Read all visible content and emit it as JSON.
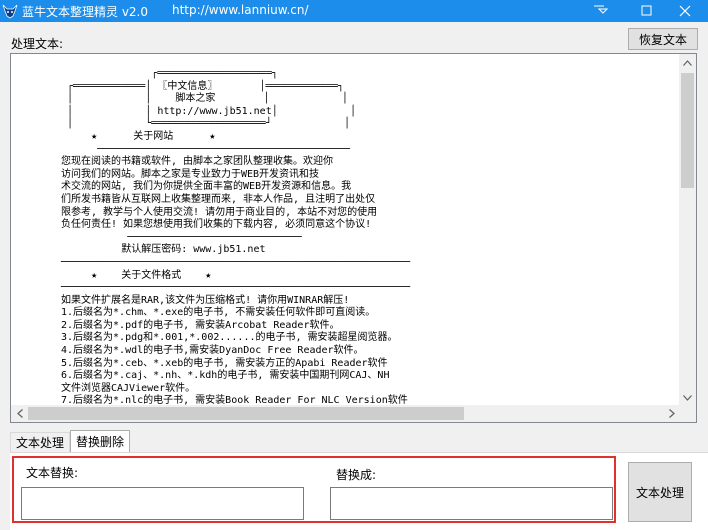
{
  "window": {
    "title": "蓝牛文本整理精灵 v2.0",
    "url": "http://www.lanniuw.cn/",
    "colors": {
      "titlebar": "#1c8dea",
      "highlight_border": "#e0322d"
    }
  },
  "labels": {
    "process_text": "处理文本:"
  },
  "buttons": {
    "restore": "恢复文本",
    "process": "文本处理"
  },
  "text_area": {
    "lines": [
      "               ┌═══════════════════┐",
      " ┌════════════│ 〖中文信息〗       │════════════┐",
      " │            │    脚本之家        │            │",
      " │            │ http://www.jb51.net│            │",
      " │            └═══════════════════┘            │",
      "     ★      关于网站      ★",
      "      ──────────────────────────────────────────",
      "您现在阅读的书籍或软件, 由脚本之家团队整理收集。欢迎你",
      "访问我们的网站。脚本之家是专业致力于WEB开发资讯和技",
      "术交流的网站, 我们为你提供全面丰富的WEB开发资源和信息。我",
      "们所发书籍皆从互联网上收集整理而来, 非本人作品, 且注明了出处仅",
      "限参考, 教学与个人使用交流! 请勿用于商业目的, 本站不对您的使用",
      "负任何责任! 如果您想使用我们收集的下载内容, 必须同意这个协议!",
      "           ─────────────────────────────",
      "          默认解压密码: www.jb51.net",
      "──────────────────────────────────────────────────────────",
      "     ★    关于文件格式    ★",
      "──────────────────────────────────────────────────────────",
      "如果文件扩展名是RAR,该文件为压缩格式! 请你用WINRAR解压!",
      "1.后缀名为*.chm、*.exe的电子书, 不需安装任何软件即可直阅读。",
      "2.后缀名为*.pdf的电子书, 需安装Arcobat Reader软件。",
      "3.后缀名为*.pdg和*.001,*.002......的电子书, 需安装超星阅览器。",
      "4.后缀名为*.wdl的电子书,需安装DyanDoc Free Reader软件。",
      "5.后缀名为*.ceb、*.xeb的电子书, 需安装方正的Apabi Reader软件",
      "6.后缀名为*.caj、*.nh、*.kdh的电子书, 需安装中国期刊网CAJ、NH",
      "文件浏览器CAJViewer软件。",
      "7.后缀名为*.nlc的电子书, 需安装Book Reader For NLC Version软件"
    ]
  },
  "tabs": [
    {
      "label": "文本处理"
    },
    {
      "label": "替换删除"
    }
  ],
  "replace": {
    "find_label": "文本替换:",
    "replace_label": "替换成:",
    "find_value": "",
    "replace_value": ""
  },
  "icons": {
    "app": "bull-head-icon",
    "minimize": "minimize-icon",
    "maximize": "maximize-icon",
    "close": "close-icon",
    "pin": "pin-icon"
  }
}
